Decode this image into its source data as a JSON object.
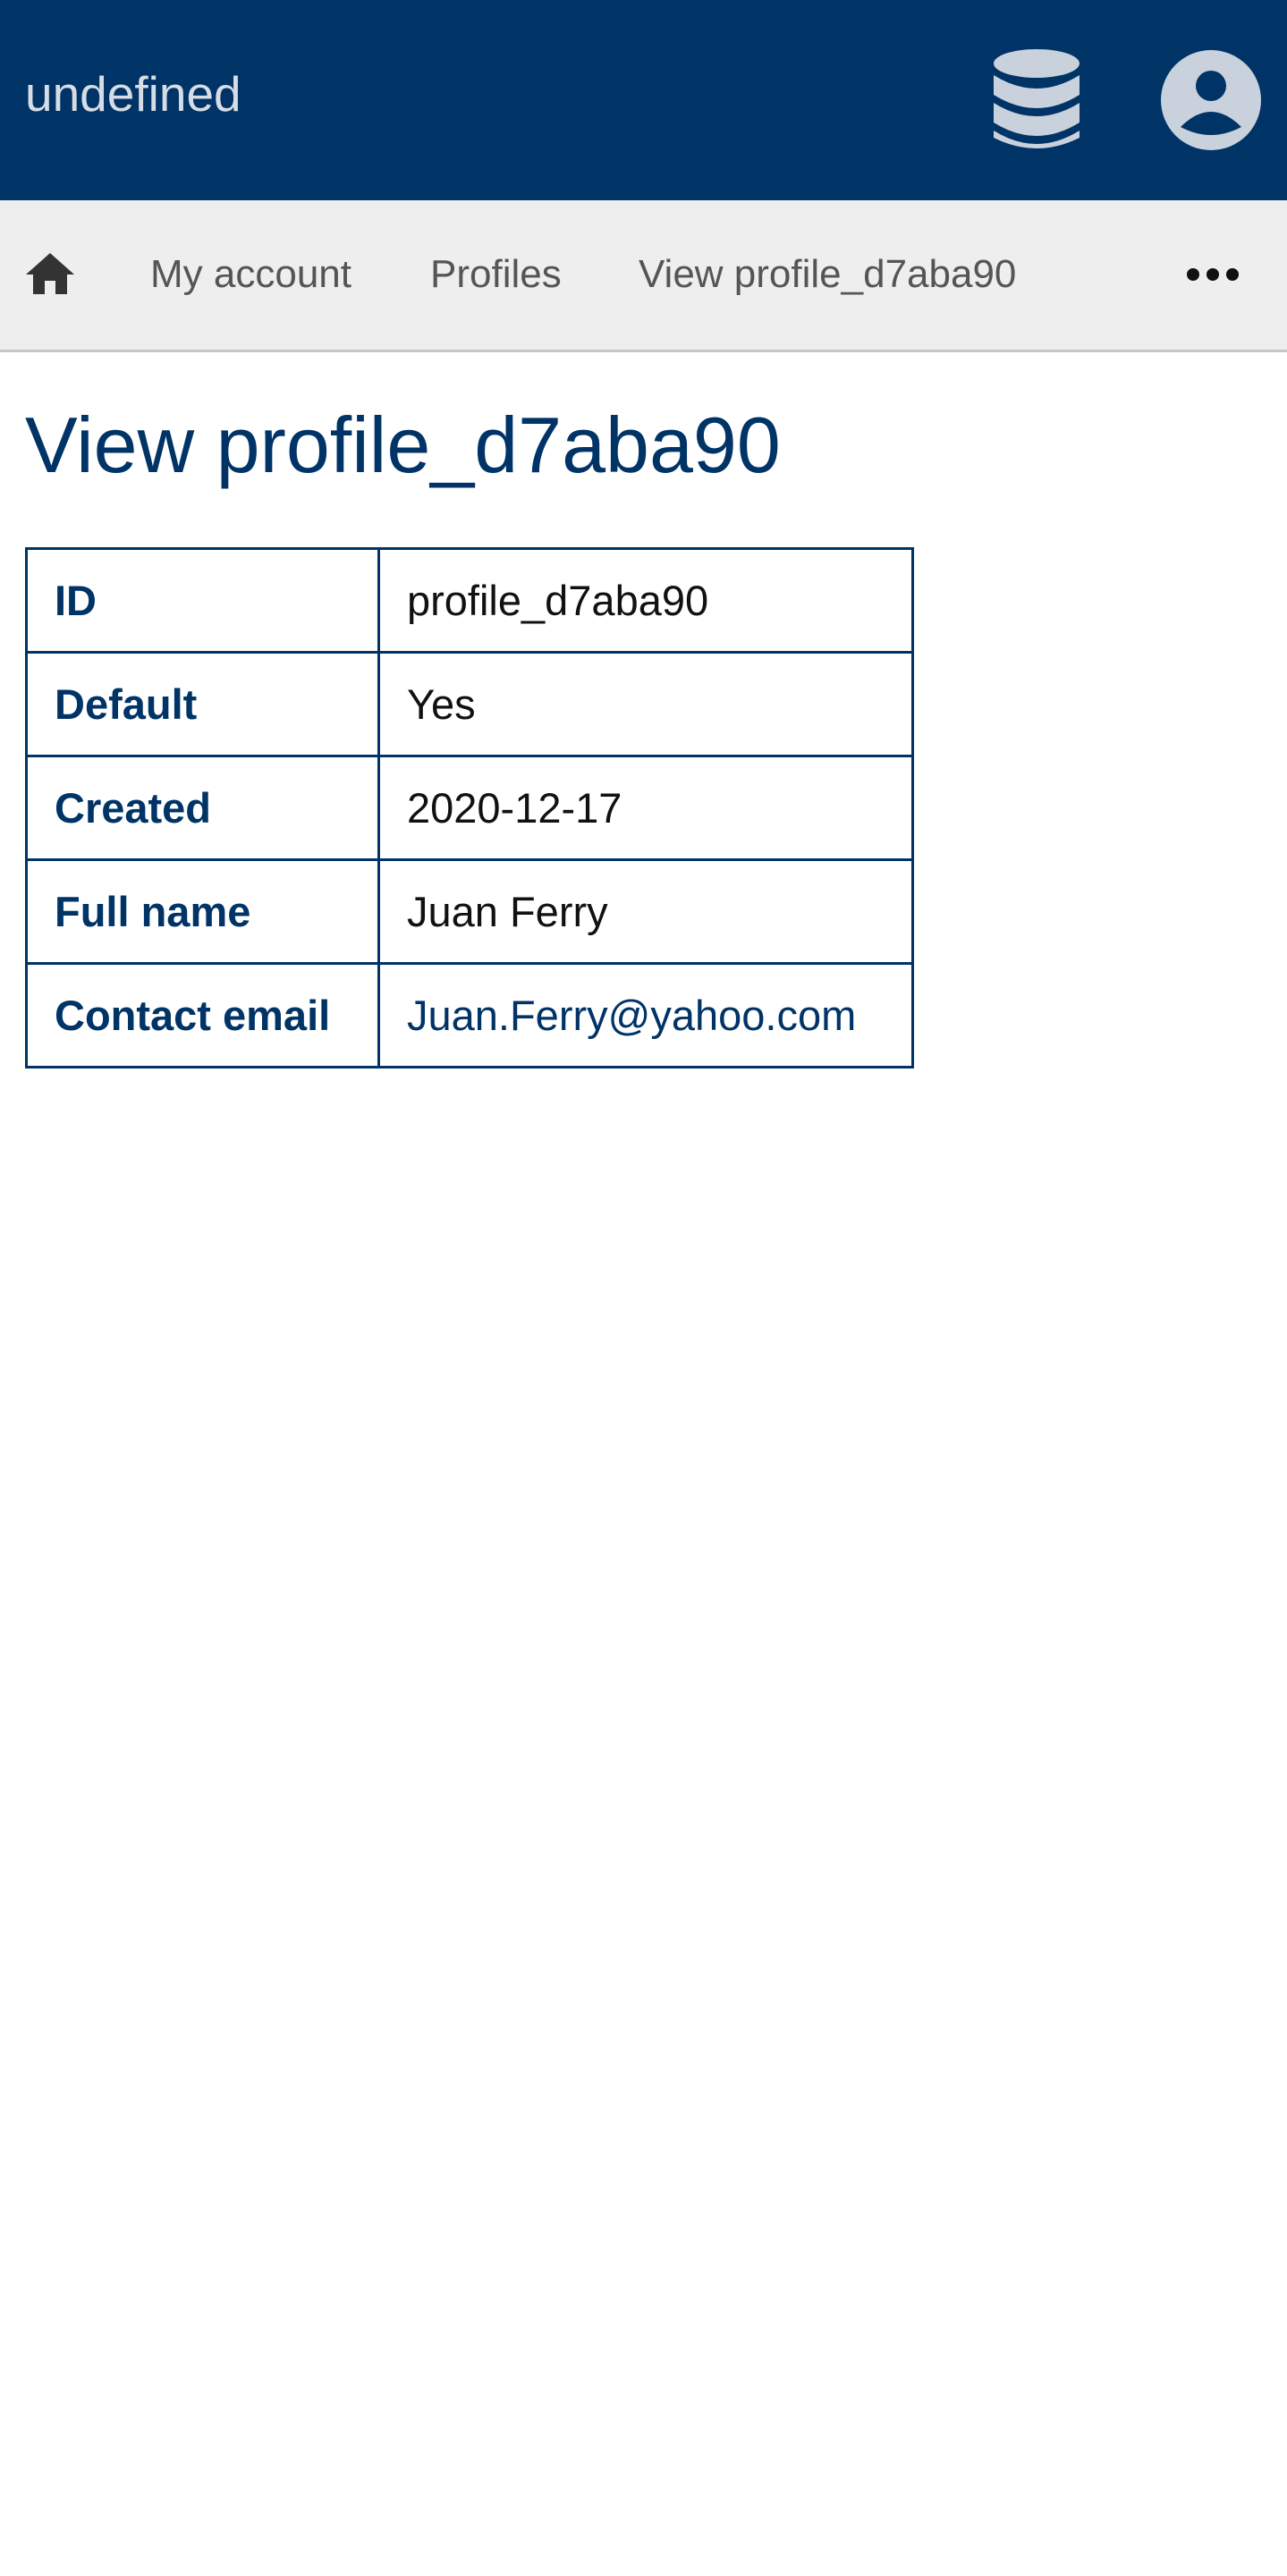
{
  "app": {
    "title": "undefined"
  },
  "header": {
    "database_icon": "database-icon",
    "user_icon": "user-circle-icon"
  },
  "breadcrumb": {
    "home_icon": "home-icon",
    "items": [
      {
        "label": "My account"
      },
      {
        "label": "Profiles"
      },
      {
        "label": "View profile_d7aba90"
      }
    ],
    "more_icon": "more-horizontal-icon"
  },
  "page": {
    "title": "View profile_d7aba90"
  },
  "profile": {
    "rows": [
      {
        "label": "ID",
        "value": "profile_d7aba90"
      },
      {
        "label": "Default",
        "value": "Yes"
      },
      {
        "label": "Created",
        "value": "2020-12-17"
      },
      {
        "label": "Full name",
        "value": "Juan Ferry"
      },
      {
        "label": "Contact email",
        "value": "Juan.Ferry@yahoo.com"
      }
    ]
  },
  "colors": {
    "brand": "#003366",
    "nav_background": "#eeeeee",
    "icon_light": "#c9d1dc"
  }
}
